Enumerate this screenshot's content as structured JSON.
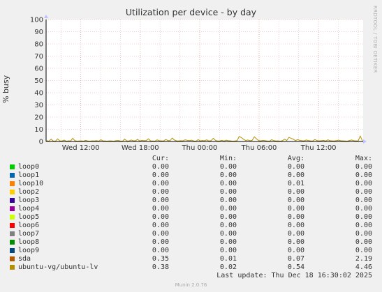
{
  "graph": {
    "title": "Utilization per device - by day",
    "ylabel": "% busy",
    "watermark": "RRDTOOL / TOBI OETIKER",
    "footer": "Munin 2.0.76",
    "last_update": "Last update: Thu Dec 18 16:30:02 2025"
  },
  "columns": [
    "Cur:",
    "Min:",
    "Avg:",
    "Max:"
  ],
  "colors": {
    "background": "#f0f0f0",
    "plot_bg": "#ffffff",
    "grid": "#e8a0a0",
    "axis": "#000000",
    "arrow": "#c0c0ff"
  },
  "chart_data": {
    "type": "line",
    "title": "Utilization per device - by day",
    "xlabel": "",
    "ylabel": "% busy",
    "ylim": [
      0,
      100
    ],
    "yticks": [
      0,
      10,
      20,
      30,
      40,
      50,
      60,
      70,
      80,
      90,
      100
    ],
    "xlim": [
      "Wed 08:30",
      "Thu 16:30"
    ],
    "xticks": [
      "Wed 12:00",
      "Wed 18:00",
      "Thu 00:00",
      "Thu 06:00",
      "Thu 12:00"
    ],
    "grid": true,
    "legend_position": "bottom",
    "series": [
      {
        "name": "loop0",
        "color": "#00cc00",
        "cur": "0.00",
        "min": "0.00",
        "avg": "0.00",
        "max": "0.00"
      },
      {
        "name": "loop1",
        "color": "#0066b3",
        "cur": "0.00",
        "min": "0.00",
        "avg": "0.00",
        "max": "0.00"
      },
      {
        "name": "loop10",
        "color": "#ff8000",
        "cur": "0.00",
        "min": "0.00",
        "avg": "0.01",
        "max": "0.00"
      },
      {
        "name": "loop2",
        "color": "#ffcc00",
        "cur": "0.00",
        "min": "0.00",
        "avg": "0.00",
        "max": "0.00"
      },
      {
        "name": "loop3",
        "color": "#330099",
        "cur": "0.00",
        "min": "0.00",
        "avg": "0.00",
        "max": "0.00"
      },
      {
        "name": "loop4",
        "color": "#990099",
        "cur": "0.00",
        "min": "0.00",
        "avg": "0.00",
        "max": "0.00"
      },
      {
        "name": "loop5",
        "color": "#ccff00",
        "cur": "0.00",
        "min": "0.00",
        "avg": "0.00",
        "max": "0.00"
      },
      {
        "name": "loop6",
        "color": "#ff0000",
        "cur": "0.00",
        "min": "0.00",
        "avg": "0.00",
        "max": "0.00"
      },
      {
        "name": "loop7",
        "color": "#808080",
        "cur": "0.00",
        "min": "0.00",
        "avg": "0.00",
        "max": "0.00"
      },
      {
        "name": "loop8",
        "color": "#008f00",
        "cur": "0.00",
        "min": "0.00",
        "avg": "0.00",
        "max": "0.00"
      },
      {
        "name": "loop9",
        "color": "#00487d",
        "cur": "0.00",
        "min": "0.00",
        "avg": "0.00",
        "max": "0.00"
      },
      {
        "name": "sda",
        "color": "#b35a00",
        "cur": "0.35",
        "min": "0.01",
        "avg": "0.07",
        "max": "2.19"
      },
      {
        "name": "ubuntu-vg/ubuntu-lv",
        "color": "#b38f00",
        "cur": "0.38",
        "min": "0.02",
        "avg": "0.54",
        "max": "4.46",
        "values": [
          0.6,
          0.3,
          1.8,
          0.4,
          0.3,
          2.1,
          0.5,
          0.4,
          1.1,
          0.3,
          0.5,
          0.4,
          2.6,
          0.6,
          0.3,
          0.4,
          0.5,
          0.3,
          0.9,
          0.4,
          0.3,
          0.5,
          0.4,
          0.6,
          0.3,
          1.4,
          0.5,
          0.4,
          0.3,
          0.5,
          0.4,
          0.3,
          0.6,
          0.8,
          0.4,
          0.3,
          1.9,
          0.5,
          0.4,
          1.2,
          0.6,
          0.5,
          1.7,
          0.4,
          0.9,
          0.6,
          0.8,
          2.2,
          0.5,
          0.4,
          0.3,
          1.3,
          0.6,
          0.5,
          0.4,
          1.6,
          0.8,
          0.6,
          2.8,
          1.2,
          0.5,
          0.4,
          0.6,
          0.5,
          1.4,
          0.9,
          0.7,
          1.1,
          0.4,
          0.3,
          1.5,
          0.5,
          0.8,
          0.6,
          1.3,
          0.4,
          0.7,
          2.6,
          1.0,
          0.4,
          0.5,
          0.9,
          0.4,
          1.1,
          0.6,
          0.5,
          0.3,
          0.4,
          0.6,
          4.1,
          3.2,
          1.8,
          0.8,
          1.2,
          0.6,
          0.9,
          3.8,
          2.2,
          0.7,
          0.5,
          0.9,
          0.6,
          0.4,
          0.3,
          1.5,
          0.7,
          0.4,
          0.5,
          0.3,
          0.6,
          1.9,
          0.8,
          3.4,
          2.6,
          1.9,
          0.7,
          1.5,
          0.9,
          0.6,
          0.5,
          1.2,
          0.8,
          0.5,
          0.4,
          1.6,
          0.7,
          0.5,
          0.6,
          0.9,
          0.4,
          1.3,
          0.6,
          0.5,
          0.4,
          0.7,
          1.1,
          0.6,
          0.5,
          0.4,
          0.3,
          0.8,
          1.2,
          0.6,
          0.5,
          0.4,
          4.46,
          0.38
        ]
      }
    ]
  }
}
